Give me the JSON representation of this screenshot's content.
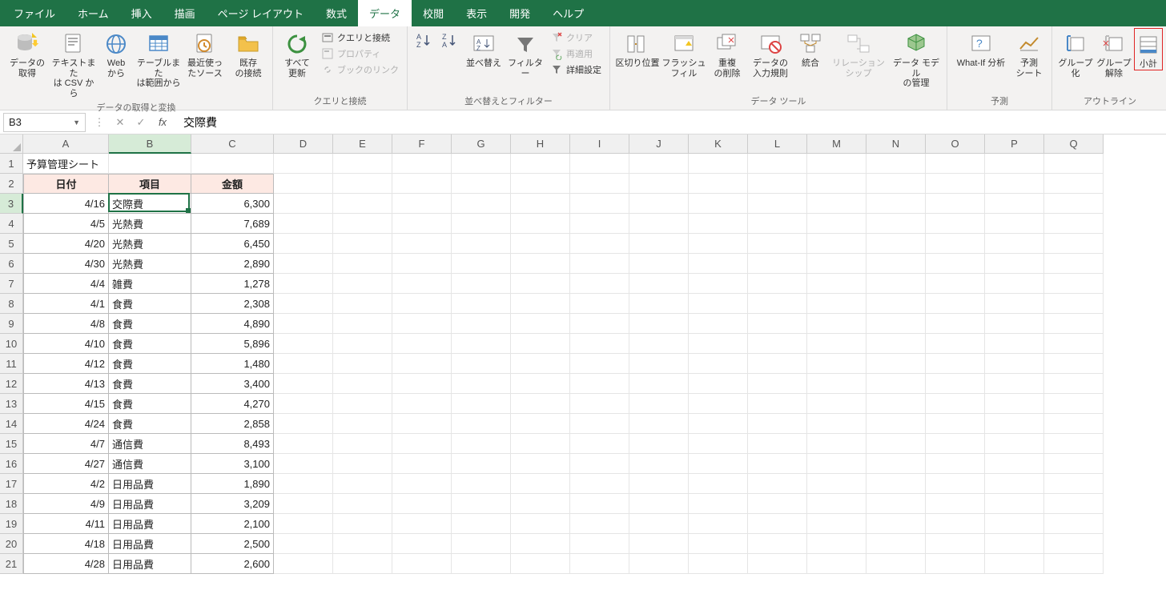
{
  "tabs": {
    "file": "ファイル",
    "home": "ホーム",
    "insert": "挿入",
    "draw": "描画",
    "pagelayout": "ページ レイアウト",
    "formulas": "数式",
    "data": "データ",
    "review": "校閲",
    "view": "表示",
    "developer": "開発",
    "help": "ヘルプ"
  },
  "active_tab": "data",
  "ribbon": {
    "group_get": "データの取得と変換",
    "get_data": "データの\n取得",
    "from_text": "テキストまた\nは CSV から",
    "from_web": "Web\nから",
    "from_table": "テーブルまた\nは範囲から",
    "recent": "最近使っ\nたソース",
    "existing": "既存\nの接続",
    "group_query": "クエリと接続",
    "refresh_all": "すべて\n更新",
    "queries_conn": "クエリと接続",
    "properties": "プロパティ",
    "workbook_links": "ブックのリンク",
    "group_sort": "並べ替えとフィルター",
    "sort": "並べ替え",
    "filter": "フィルター",
    "clear": "クリア",
    "reapply": "再適用",
    "advanced": "詳細設定",
    "group_tools": "データ ツール",
    "text_to_col": "区切り位置",
    "flash_fill": "フラッシュ\nフィル",
    "remove_dup": "重複\nの削除",
    "data_val": "データの\n入力規則",
    "consolidate": "統合",
    "relationships": "リレーションシップ",
    "data_model": "データ モデル\nの管理",
    "group_forecast": "予測",
    "whatif": "What-If 分析",
    "forecast_sheet": "予測\nシート",
    "group_outline": "アウトライン",
    "group_btn": "グループ\n化",
    "ungroup_btn": "グループ\n解除",
    "subtotal": "小計"
  },
  "name_box": "B3",
  "formula": "交際費",
  "cols": [
    "A",
    "B",
    "C",
    "D",
    "E",
    "F",
    "G",
    "H",
    "I",
    "J",
    "K",
    "L",
    "M",
    "N",
    "O",
    "P",
    "Q"
  ],
  "col_widths": {
    "A": 107,
    "B": 103,
    "C": 103,
    "default": 74
  },
  "selected_col_index": 1,
  "selected_row_number": 3,
  "data_cols": 3,
  "data_start_row": 2,
  "rows_total": 21,
  "sheet": {
    "title": "予算管理シート",
    "headers": [
      "日付",
      "項目",
      "金額"
    ],
    "rows": [
      {
        "date": "4/16",
        "item": "交際費",
        "amount": "6,300"
      },
      {
        "date": "4/5",
        "item": "光熱費",
        "amount": "7,689"
      },
      {
        "date": "4/20",
        "item": "光熱費",
        "amount": "6,450"
      },
      {
        "date": "4/30",
        "item": "光熱費",
        "amount": "2,890"
      },
      {
        "date": "4/4",
        "item": "雑費",
        "amount": "1,278"
      },
      {
        "date": "4/1",
        "item": "食費",
        "amount": "2,308"
      },
      {
        "date": "4/8",
        "item": "食費",
        "amount": "4,890"
      },
      {
        "date": "4/10",
        "item": "食費",
        "amount": "5,896"
      },
      {
        "date": "4/12",
        "item": "食費",
        "amount": "1,480"
      },
      {
        "date": "4/13",
        "item": "食費",
        "amount": "3,400"
      },
      {
        "date": "4/15",
        "item": "食費",
        "amount": "4,270"
      },
      {
        "date": "4/24",
        "item": "食費",
        "amount": "2,858"
      },
      {
        "date": "4/7",
        "item": "通信費",
        "amount": "8,493"
      },
      {
        "date": "4/27",
        "item": "通信費",
        "amount": "3,100"
      },
      {
        "date": "4/2",
        "item": "日用品費",
        "amount": "1,890"
      },
      {
        "date": "4/9",
        "item": "日用品費",
        "amount": "3,209"
      },
      {
        "date": "4/11",
        "item": "日用品費",
        "amount": "2,100"
      },
      {
        "date": "4/18",
        "item": "日用品費",
        "amount": "2,500"
      },
      {
        "date": "4/28",
        "item": "日用品費",
        "amount": "2,600"
      }
    ]
  }
}
